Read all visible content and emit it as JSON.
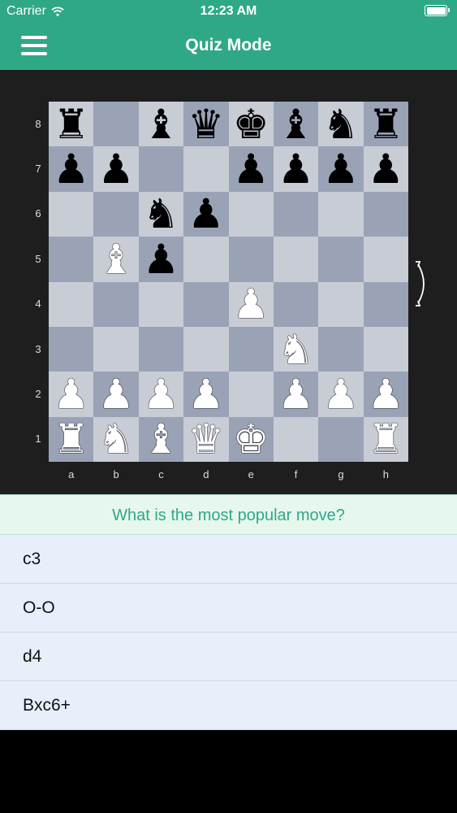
{
  "status_bar": {
    "carrier": "Carrier",
    "time": "12:23 AM"
  },
  "nav": {
    "title": "Quiz Mode"
  },
  "board": {
    "ranks": [
      "8",
      "7",
      "6",
      "5",
      "4",
      "3",
      "2",
      "1"
    ],
    "files": [
      "a",
      "b",
      "c",
      "d",
      "e",
      "f",
      "g",
      "h"
    ],
    "rows": [
      [
        "br",
        "",
        "bb",
        "bq",
        "bk",
        "bb",
        "bn",
        "br"
      ],
      [
        "bp",
        "bp",
        "",
        "",
        "bp",
        "bp",
        "bp",
        "bp"
      ],
      [
        "",
        "",
        "bn",
        "bp",
        "",
        "",
        "",
        ""
      ],
      [
        "",
        "wb",
        "bp",
        "",
        "",
        "",
        "",
        ""
      ],
      [
        "",
        "",
        "",
        "",
        "wp",
        "",
        "",
        ""
      ],
      [
        "",
        "",
        "",
        "",
        "",
        "wn",
        "",
        ""
      ],
      [
        "wp",
        "wp",
        "wp",
        "wp",
        "",
        "wp",
        "wp",
        "wp"
      ],
      [
        "wr",
        "wn",
        "wb",
        "wq",
        "wk",
        "",
        "",
        "wr"
      ]
    ]
  },
  "quiz": {
    "question": "What is the most popular move?",
    "answers": [
      "c3",
      "O-O",
      "d4",
      "Bxc6+"
    ]
  },
  "colors": {
    "accent": "#2fa887",
    "light_square": "#c8ccd5",
    "dark_square": "#9aa3b6"
  }
}
